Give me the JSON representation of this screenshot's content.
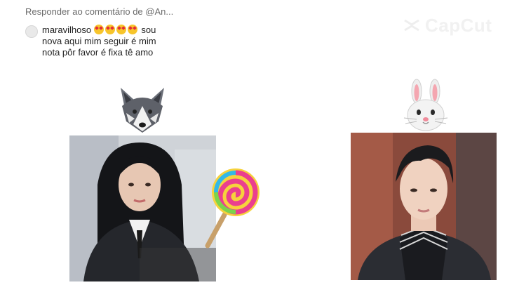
{
  "header": {
    "reply_label": "Responder ao comentário de @An..."
  },
  "comment": {
    "username": "maravilhoso",
    "emoji_names": [
      "heart-eyes-emoji",
      "heart-eyes-emoji",
      "heart-eyes-emoji",
      "heart-eyes-emoji"
    ],
    "line1_rest": " sou",
    "line2": "nova aqui mim seguir é mim",
    "line3": "nota pôr favor é fixa tê amo"
  },
  "watermark": {
    "text": "CapCut"
  },
  "icons": {
    "left_animal": "wolf-icon",
    "right_animal": "rabbit-icon",
    "candy": "lollipop-icon"
  },
  "colors": {
    "background": "#ffffff",
    "header_text": "#6b6b6b",
    "comment_text": "#222222"
  }
}
